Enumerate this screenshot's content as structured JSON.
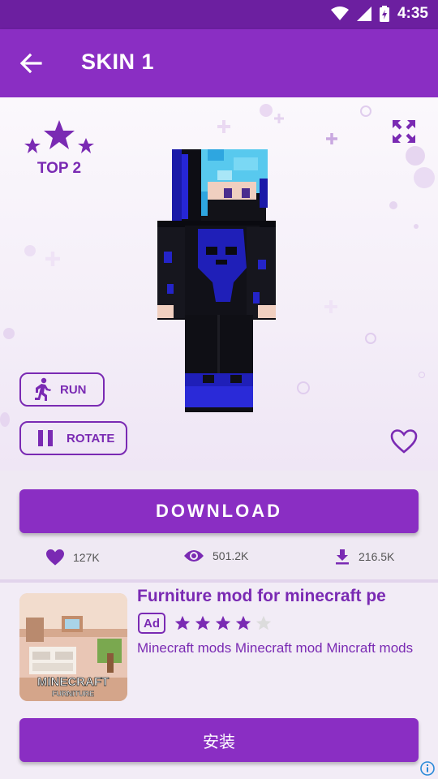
{
  "status_bar": {
    "time": "4:35"
  },
  "app_bar": {
    "title": "SKIN 1"
  },
  "viewer": {
    "rank_label": "TOP 2",
    "run_label": "RUN",
    "rotate_label": "ROTATE"
  },
  "download_label": "DOWNLOAD",
  "stats": {
    "likes": "127K",
    "views": "501.2K",
    "downloads": "216.5K"
  },
  "ad": {
    "title": "Furniture mod for minecraft pe",
    "badge": "Ad",
    "rating": 4,
    "rating_max": 5,
    "description": "Minecraft mods Minecraft mod Mincraft mods",
    "thumb_text_1": "MINECRAFT",
    "thumb_text_2": "FURNITURE",
    "install_label": "安装"
  },
  "colors": {
    "primary": "#8a2ec3",
    "status_bar": "#6c1fa0",
    "accent": "#7a2ab3"
  }
}
